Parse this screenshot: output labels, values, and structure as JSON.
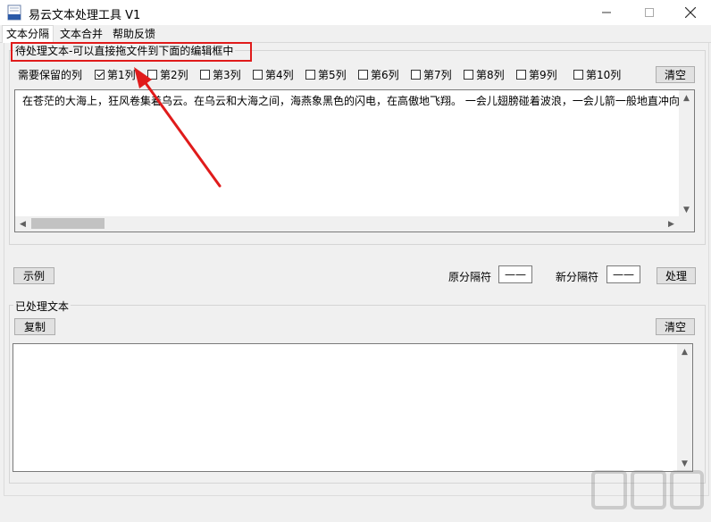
{
  "window": {
    "title": "易云文本处理工具 V1",
    "min_icon": "minimize-icon",
    "max_icon": "maximize-icon",
    "close_icon": "close-icon"
  },
  "tabs": [
    {
      "label": "文本分隔",
      "active": true
    },
    {
      "label": "文本合并",
      "active": false
    },
    {
      "label": "帮助反馈",
      "active": false
    }
  ],
  "input_group": {
    "title": "待处理文本-可以直接拖文件到下面的编辑框中",
    "keep_label": "需要保留的列",
    "columns": [
      {
        "label": "第1列",
        "checked": true
      },
      {
        "label": "第2列",
        "checked": false
      },
      {
        "label": "第3列",
        "checked": false
      },
      {
        "label": "第4列",
        "checked": false
      },
      {
        "label": "第5列",
        "checked": false
      },
      {
        "label": "第6列",
        "checked": false
      },
      {
        "label": "第7列",
        "checked": false
      },
      {
        "label": "第8列",
        "checked": false
      },
      {
        "label": "第9列",
        "checked": false
      },
      {
        "label": "第10列",
        "checked": false
      }
    ],
    "clear_label": "清空",
    "text_value": "在苍茫的大海上，狂风卷集着乌云。在乌云和大海之间，海燕象黑色的闪电，在高傲地飞翔。 一会儿翅膀碰着波浪，一会儿箭一般地直冲向"
  },
  "controls": {
    "example_label": "示例",
    "orig_sep_label": "原分隔符",
    "orig_sep_value": "——",
    "new_sep_label": "新分隔符",
    "new_sep_value": "——",
    "process_label": "处理"
  },
  "output_group": {
    "title": "已处理文本",
    "copy_label": "复制",
    "clear_label": "清空",
    "text_value": ""
  },
  "annotation": {
    "color": "#e01b1b"
  }
}
